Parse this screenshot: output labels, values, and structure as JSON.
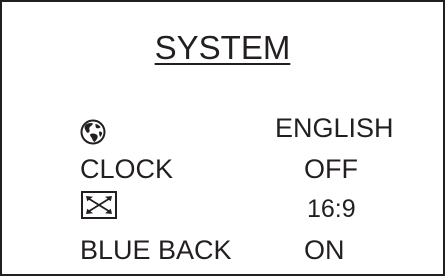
{
  "menu": {
    "title": "SYSTEM",
    "items": [
      {
        "key": "language",
        "icon": "globe-icon",
        "label": "",
        "value": "ENGLISH"
      },
      {
        "key": "clock",
        "label": "CLOCK",
        "value": "OFF"
      },
      {
        "key": "aspect_ratio",
        "icon": "aspect-ratio-icon",
        "label": "",
        "value": "16:9"
      },
      {
        "key": "blue_back",
        "label": "BLUE BACK",
        "value": "ON"
      }
    ]
  },
  "colors": {
    "foreground": "#231f20",
    "background": "#ffffff"
  }
}
